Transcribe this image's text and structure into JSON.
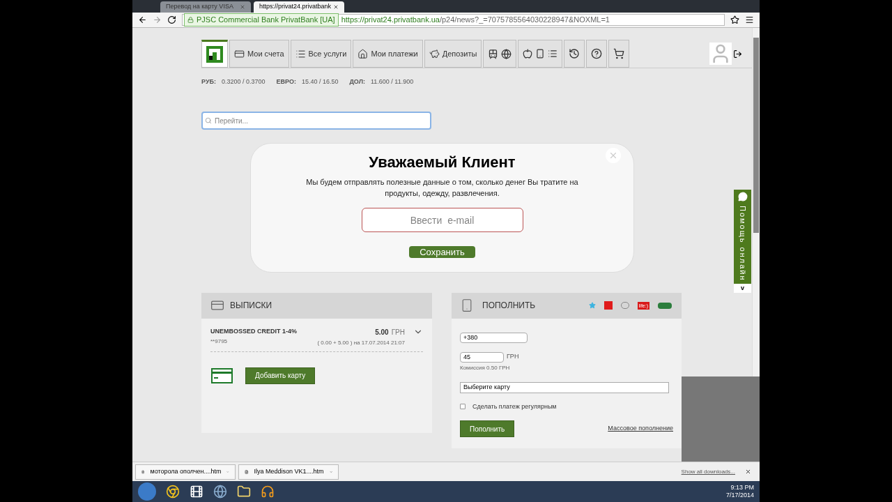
{
  "browser": {
    "tabs": [
      {
        "title": "Перевод на карту VISA",
        "selected": false
      },
      {
        "title": "https://privat24.privatbank",
        "selected": true
      }
    ],
    "secure_label": "PJSC Commercial Bank PrivatBank [UA]",
    "url_host": "https://privat24.privatbank.ua",
    "url_path": "/p24/news?_=7075785564030228947&NOXML=1"
  },
  "nav": [
    {
      "kind": "logo",
      "selected": true
    },
    {
      "kind": "accounts",
      "label": "Мои счета",
      "selected": false
    },
    {
      "kind": "services",
      "label": "Все услуги",
      "selected": false
    },
    {
      "kind": "payments",
      "label": "Мои платежи",
      "selected": false
    },
    {
      "kind": "deposits",
      "label": "Депозиты",
      "selected": false
    },
    {
      "kind": "travel",
      "selected": false
    },
    {
      "kind": "mobile",
      "selected": false
    },
    {
      "kind": "history",
      "selected": false
    },
    {
      "kind": "help",
      "selected": false
    },
    {
      "kind": "cart",
      "selected": false
    }
  ],
  "rates": [
    {
      "name": "РУБ:",
      "value": "0.3200 / 0.3700"
    },
    {
      "name": "ЕВРО:",
      "value": "15.40 / 16.50"
    },
    {
      "name": "ДОЛ:",
      "value": "11.600 / 11.900"
    }
  ],
  "search": {
    "placeholder": "Перейти..."
  },
  "popup": {
    "title": "Уважаемый Клиент",
    "text": "Мы будем отправлять полезные данные о том, сколько денег Вы тратите на продукты, одежду, развлечения.",
    "email_placeholder": "Ввести  e-mail",
    "button": "Сохранить"
  },
  "statements": {
    "title": "ВЫПИСКИ",
    "card": {
      "name": "UNEMBOSSED CREDIT 1-4%",
      "number": "**9795",
      "amount": "5.00",
      "currency": "ГРН",
      "detail": "( 0.00 + 5.00 ) на 17.07.2014 21:07"
    },
    "button": "Добавить карту"
  },
  "topup": {
    "title": "ПОПОЛНИТЬ",
    "operators": [
      "life:)"
    ],
    "phone": "+380",
    "amount": "45",
    "currency": "ГРН",
    "commission": "Комиссия 0.50 ГРН",
    "card_placeholder": "Выберите карту",
    "regular": {
      "label": "Сделать платеж регулярным",
      "checked": false
    },
    "button": "Пополнить",
    "link": "Массовое пополнение"
  },
  "help_tab": {
    "label": "Помощь онлайн",
    "toggle": "v"
  },
  "downloads": {
    "items": [
      {
        "name": "моторола ополчен....htm"
      },
      {
        "name": "Ilya Meddison   VK1....htm"
      }
    ],
    "show_all": "Show all downloads..."
  },
  "taskbar": {
    "time": "9:13 PM",
    "date": "7/17/2014"
  }
}
